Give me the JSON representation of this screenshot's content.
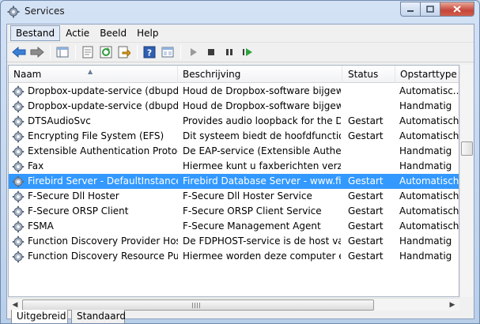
{
  "window": {
    "title": "Services"
  },
  "menu": [
    "Bestand",
    "Actie",
    "Beeld",
    "Help"
  ],
  "toolbar_icons": [
    "back-arrow-icon",
    "forward-arrow-icon",
    "console-tree-icon",
    "properties-icon",
    "refresh-icon",
    "export-list-icon",
    "help-icon",
    "view-icon",
    "start-service-icon",
    "stop-service-icon",
    "pause-service-icon",
    "restart-service-icon"
  ],
  "columns": {
    "name": "Naam",
    "description": "Beschrijving",
    "status": "Status",
    "startup": "Opstarttype"
  },
  "rows": [
    {
      "name": "Dropbox-update-service (dbupda...",
      "description": "Houd de Dropbox-software bijgew...",
      "status": "",
      "startup": "Automatisc..."
    },
    {
      "name": "Dropbox-update-service (dbupda...",
      "description": "Houd de Dropbox-software bijgew...",
      "status": "",
      "startup": "Handmatig"
    },
    {
      "name": "DTSAudioSvc",
      "description": "Provides audio loopback for the DT...",
      "status": "Gestart",
      "startup": "Automatisch"
    },
    {
      "name": "Encrypting File System (EFS)",
      "description": "Dit systeem biedt de hoofdfunction...",
      "status": "Gestart",
      "startup": "Automatisch"
    },
    {
      "name": "Extensible Authentication Protocol",
      "description": "De EAP-service (Extensible Authenti...",
      "status": "",
      "startup": "Handmatig"
    },
    {
      "name": "Fax",
      "description": "Hiermee kunt u faxberichten verzen...",
      "status": "",
      "startup": "Handmatig"
    },
    {
      "name": "Firebird Server - DefaultInstance",
      "description": "Firebird Database Server - www.fire...",
      "status": "Gestart",
      "startup": "Automatisch",
      "selected": true
    },
    {
      "name": "F-Secure Dll Hoster",
      "description": "F-Secure Dll Hoster Service",
      "status": "Gestart",
      "startup": "Automatisch"
    },
    {
      "name": "F-Secure ORSP Client",
      "description": "F-Secure ORSP Client Service",
      "status": "Gestart",
      "startup": "Automatisch"
    },
    {
      "name": "FSMA",
      "description": "F-Secure Management Agent",
      "status": "Gestart",
      "startup": "Automatisch"
    },
    {
      "name": "Function Discovery Provider Host",
      "description": "De FDPHOST-service is de host van...",
      "status": "Gestart",
      "startup": "Handmatig"
    },
    {
      "name": "Function Discovery Resource Publ...",
      "description": "Hiermee worden deze computer en...",
      "status": "Gestart",
      "startup": "Handmatig"
    }
  ],
  "tabs": [
    "Uitgebreid",
    "Standaard"
  ],
  "colors": {
    "selection": "#3399ff",
    "close_button": "#c5453a"
  }
}
